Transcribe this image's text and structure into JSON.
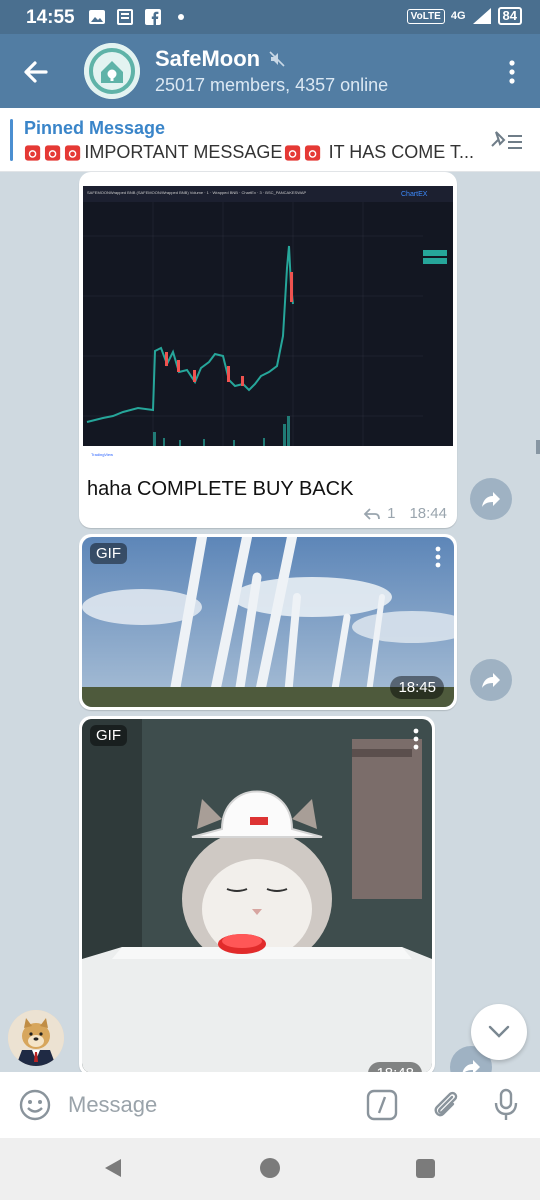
{
  "status": {
    "time": "14:55",
    "network": "4G",
    "volte": "VoLTE",
    "battery": "84"
  },
  "header": {
    "title": "SafeMoon",
    "subtitle": "25017 members, 4357 online"
  },
  "pinned": {
    "label": "Pinned Message",
    "text_a": "IMPORTANT MESSAGE",
    "text_b": "IT HAS COME T..."
  },
  "messages": [
    {
      "text": "haha COMPLETE BUY BACK",
      "replies": "1",
      "time": "18:44",
      "chart_header": "SAFEMOONWrapped BNB (SAFEMOON/Wrapped BNB) Volume · 1 · Wrapped BNB · ChartEx · 3 · BSC_PANCAKESWAP",
      "chart_brand": "ChartEX",
      "tradingview": "TradingView"
    },
    {
      "badge": "GIF",
      "time": "18:45"
    },
    {
      "badge": "GIF",
      "time": "18:48"
    }
  ],
  "input": {
    "placeholder": "Message"
  },
  "colors": {
    "header": "#527da3",
    "status_bar": "#4a6f8f",
    "accent": "#3a85c9",
    "chat_bg": "#cfd9e0"
  },
  "icons": [
    "back-arrow-icon",
    "mute-icon",
    "more-vert-icon",
    "siren-icon",
    "pinned-list-icon",
    "share-icon",
    "emoji-icon",
    "slash-command-icon",
    "attach-icon",
    "mic-icon",
    "chevron-down-icon"
  ]
}
